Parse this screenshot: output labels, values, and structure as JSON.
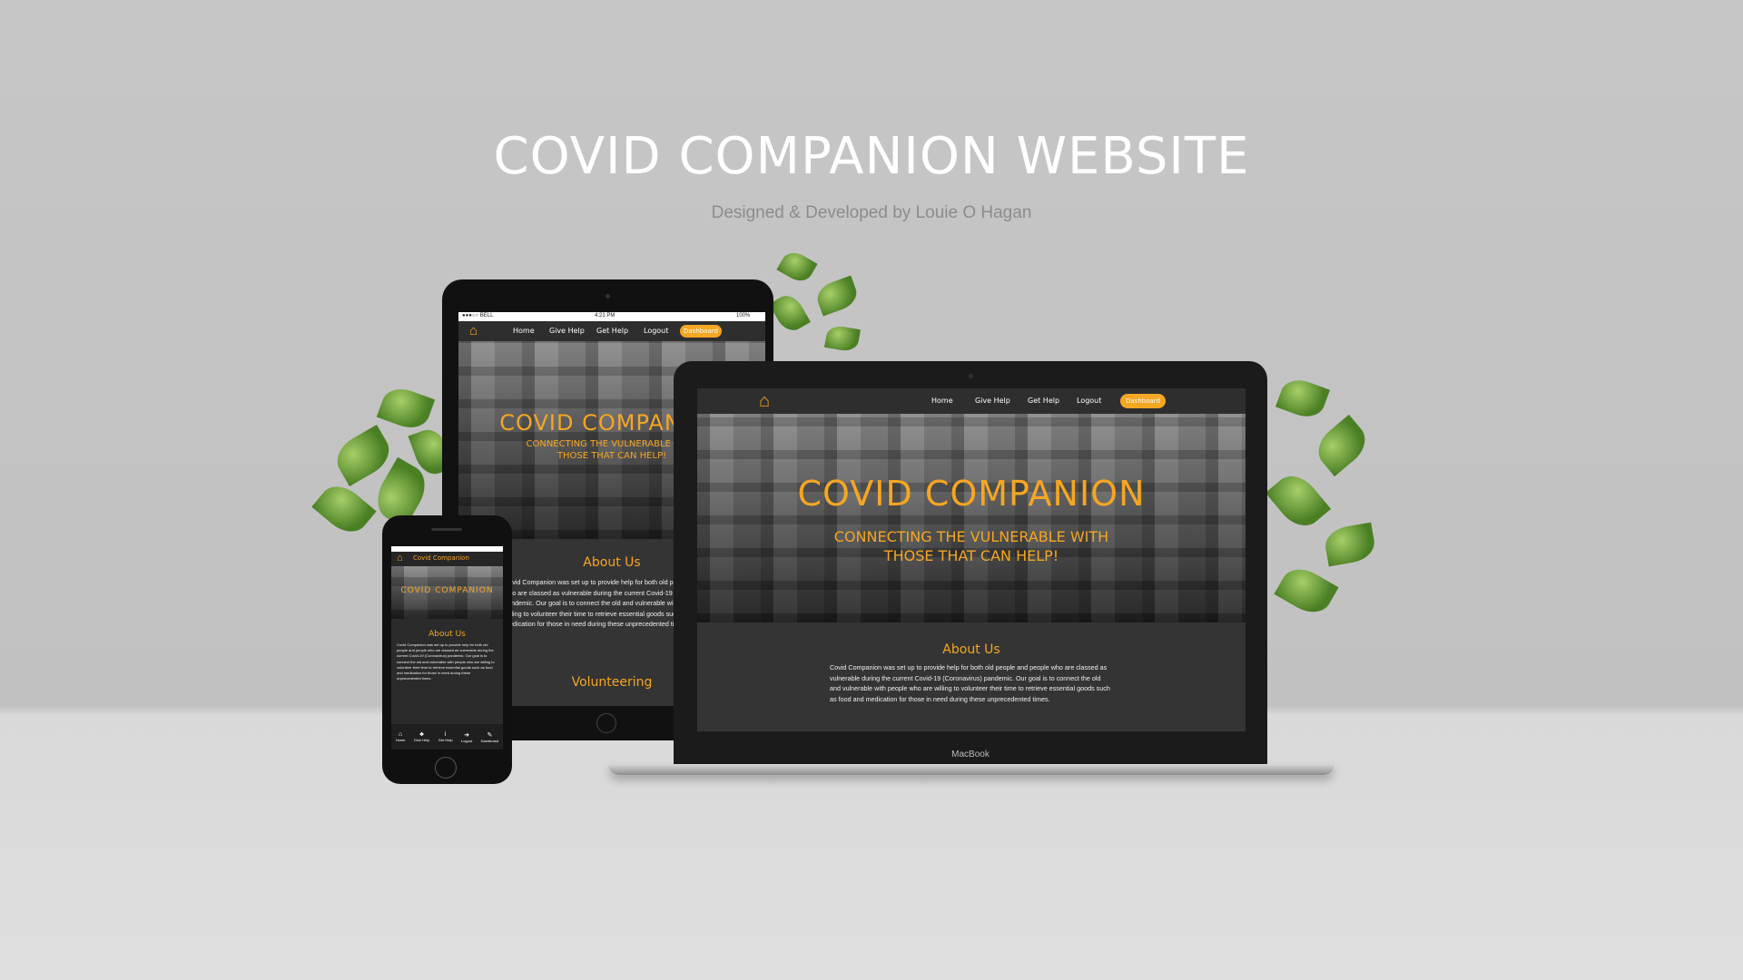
{
  "header": {
    "title": "COVID COMPANION WEBSITE",
    "subtitle": "Designed & Developed by Louie O Hagan"
  },
  "site": {
    "nav": [
      "Home",
      "Give Help",
      "Get Help",
      "Logout"
    ],
    "dashboard_label": "Dashboard",
    "hero_title": "COVID COMPANION",
    "hero_sub_line1": "CONNECTING THE VULNERABLE WITH",
    "hero_sub_line2": "THOSE THAT CAN HELP!",
    "about_heading": "About Us",
    "about_text": "Covid Companion was set up to provide help for both old people and people who are classed as vulnerable during the current Covid-19 (Coronavirus) pandemic. Our goal is to connect the old and vulnerable with people who are willing to volunteer their time to retrieve essential goods such as food and medication for those in need during these unprecedented times.",
    "volunteering_heading": "Volunteering",
    "accent_color": "#f5a623"
  },
  "mobile": {
    "brand": "Covid Companion",
    "tabs": [
      "Home",
      "Give Help",
      "Get Help",
      "Logout",
      "Dashboard"
    ]
  },
  "tablet_status": {
    "carrier": "●●●○○ BELL",
    "time": "4:21 PM",
    "battery": "100%"
  },
  "laptop": {
    "brand_label": "MacBook"
  },
  "icons": {
    "home": "house-icon"
  }
}
